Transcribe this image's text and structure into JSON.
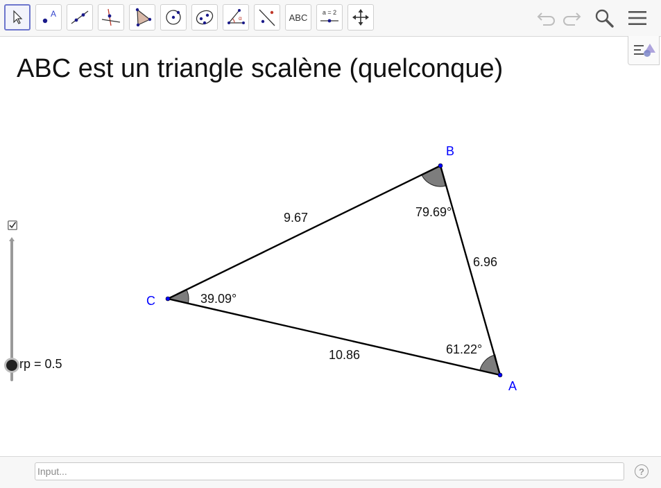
{
  "toolbar": {
    "tools": [
      {
        "name": "move-tool",
        "icon": "arrow-cursor-icon"
      },
      {
        "name": "point-tool",
        "icon": "point-icon",
        "label": "A"
      },
      {
        "name": "line-tool",
        "icon": "line-icon"
      },
      {
        "name": "perpendicular-tool",
        "icon": "perpendicular-line-icon"
      },
      {
        "name": "polygon-tool",
        "icon": "polygon-icon"
      },
      {
        "name": "circle-tool",
        "icon": "circle-center-point-icon"
      },
      {
        "name": "ellipse-tool",
        "icon": "ellipse-icon"
      },
      {
        "name": "angle-tool",
        "icon": "angle-icon"
      },
      {
        "name": "reflect-tool",
        "icon": "reflect-about-line-icon"
      },
      {
        "name": "text-tool",
        "icon": "text-icon",
        "label": "ABC"
      },
      {
        "name": "slider-tool",
        "icon": "slider-icon",
        "label": "a = 2"
      },
      {
        "name": "move-view-tool",
        "icon": "move-graphics-view-icon"
      }
    ],
    "undo_icon": "undo-icon",
    "redo_icon": "redo-icon",
    "search_icon": "search-icon",
    "menu_icon": "hamburger-menu-icon"
  },
  "style_bar_toggle_icon": "style-bar-icon",
  "title": "ABC est un triangle scalène (quelconque)",
  "geometry": {
    "points": [
      {
        "label": "A"
      },
      {
        "label": "B"
      },
      {
        "label": "C"
      }
    ],
    "side_labels": [
      "9.67",
      "6.96",
      "10.86"
    ],
    "angle_labels": [
      "79.69°",
      "39.09°",
      "61.22°"
    ],
    "point_color": "#0000ff",
    "angle_fill": "#666666"
  },
  "slider": {
    "label": "rp = 0.5",
    "value": 0.5,
    "visible_checkbox": true
  },
  "input_bar": {
    "placeholder": "Input...",
    "value": "",
    "help_icon": "help-icon",
    "help_label": "?"
  },
  "colors": {
    "accent": "#6d76cc",
    "point": "#0000ff"
  }
}
